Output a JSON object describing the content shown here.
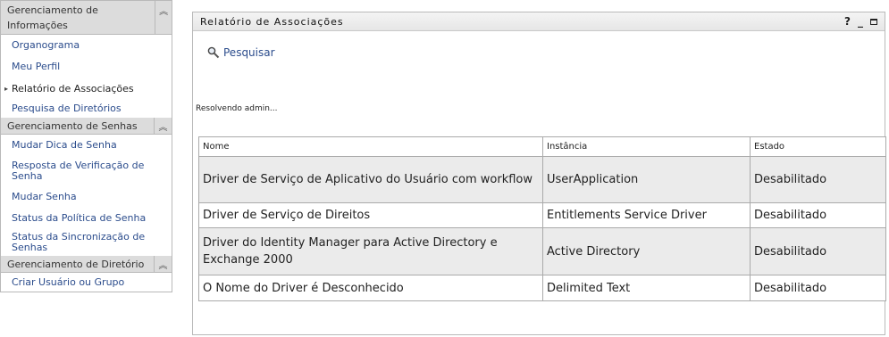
{
  "sidebar": {
    "sections": [
      {
        "title": "Gerenciamento de Informações",
        "items": [
          "Organograma",
          "Meu Perfil",
          "Relatório de Associações",
          "Pesquisa de Diretórios"
        ]
      },
      {
        "title": "Gerenciamento de Senhas",
        "items": [
          "Mudar Dica de Senha",
          "Resposta de Verificação de Senha",
          "Mudar Senha",
          "Status da Política de Senha",
          "Status da Sincronização de Senhas"
        ]
      },
      {
        "title": "Gerenciamento de Diretório",
        "items": [
          "Criar Usuário ou Grupo"
        ]
      }
    ],
    "active_item": "Relatório de Associações",
    "collapse_glyph": "︽"
  },
  "portlet": {
    "title": "Relatório de Associações",
    "help_label": "?",
    "minimize_label": "_",
    "search_label": "Pesquisar",
    "status": "Resolvendo admin...",
    "columns": [
      "Nome",
      "Instância",
      "Estado"
    ],
    "rows": [
      [
        "Driver de Serviço de Aplicativo do Usuário com workflow",
        "UserApplication",
        "Desabilitado"
      ],
      [
        "Driver de Serviço de Direitos",
        "Entitlements Service Driver",
        "Desabilitado"
      ],
      [
        "Driver do Identity Manager para Active Directory e Exchange 2000",
        "Active Directory",
        "Desabilitado"
      ],
      [
        "O Nome do Driver é Desconhecido",
        "Delimited Text",
        "Desabilitado"
      ]
    ]
  },
  "colors": {
    "link": "#2b4c8c",
    "header_bg": "#dcdcdc",
    "row_alt": "#ebebeb"
  }
}
